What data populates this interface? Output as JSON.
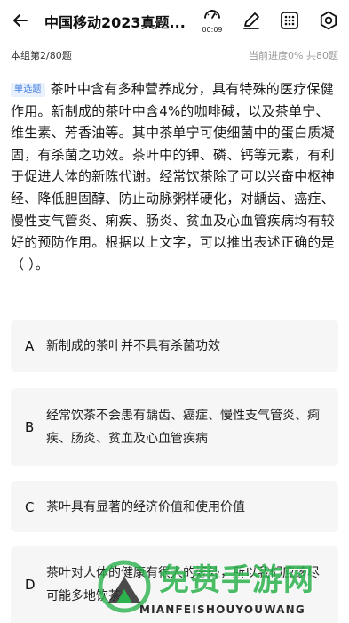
{
  "header": {
    "title": "中国移动2023真题...",
    "timer": "00:09",
    "icons": [
      "back-arrow-icon",
      "stopwatch-icon",
      "pencil-icon",
      "answer-sheet-grid-icon",
      "settings-gear-icon"
    ]
  },
  "progress": {
    "group_label": "本组第2/80题",
    "current_progress": "当前进度0%",
    "total": "共80题"
  },
  "question": {
    "type_badge": "单选题",
    "text": "茶叶中含有多种营养成分，具有特殊的医疗保健作用。新制成的茶叶中含4%的咖啡碱，以及茶单宁、维生素、芳香油等。其中茶单宁可使细菌中的蛋白质凝固，有杀菌之功效。茶叶中的钾、磷、钙等元素，有利于促进人体的新陈代谢。经常饮茶除了可以兴奋中枢神经、降低胆固醇、防止动脉粥样硬化，对龋齿、癌症、慢性支气管炎、痢疾、肠炎、贫血及心血管疾病均有较好的预防作用。根据以上文字，可以推出表述正确的是（ ）。"
  },
  "options": [
    {
      "letter": "A",
      "text": "新制成的茶叶并不具有杀菌功效"
    },
    {
      "letter": "B",
      "text": "经常饮茶不会患有龋齿、癌症、慢性支气管炎、痢疾、肠炎、贫血及心血管疾病"
    },
    {
      "letter": "C",
      "text": "茶叶具有显著的经济价值和使用价值"
    },
    {
      "letter": "D",
      "text": "茶叶对人体的健康有很大的好处，所以我们应该尽可能多地饮茶"
    }
  ],
  "watermark": {
    "title": "免费手游网",
    "subtitle": "MIANFEISHOUYOUWANG"
  },
  "colors": {
    "badge_bg": "#eaf1fe",
    "badge_text": "#3f7de0",
    "option_bg": "#f6f6f7",
    "watermark_green": "#2bb24c"
  }
}
